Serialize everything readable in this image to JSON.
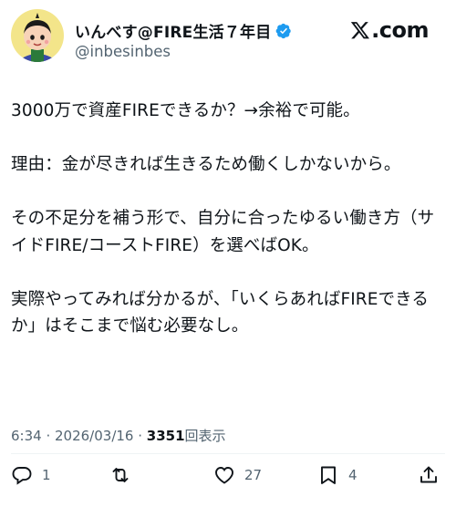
{
  "author": {
    "display_name": "いんべす@FIRE生活７年目",
    "handle": "@inbesinbes",
    "verified": true,
    "avatar_icon": "cartoon-avatar-icon"
  },
  "brand": {
    "logo_text": ".com",
    "logo_icon": "x-logo-icon"
  },
  "post": {
    "paragraphs": [
      "3000万で資産FIREできるか？→余裕で可能。",
      "理由：金が尽きれば生きるため働くしかないから。",
      "その不足分を補う形で、自分に合ったゆるい働き方（サイドFIRE/コーストFIRE）を選べばOK。",
      "実際やってみれば分かるが、「いくらあればFIREできるか」はそこまで悩む必要なし。"
    ]
  },
  "meta": {
    "time": "6:34",
    "separator": " · ",
    "date": "2026/03/16",
    "views_count": "3351",
    "views_label": "回表示"
  },
  "actions": {
    "reply_count": "1",
    "retweet_count": "",
    "like_count": "27",
    "bookmark_count": "4"
  },
  "colors": {
    "verified": "#1d9bf0",
    "muted": "#536471",
    "text": "#0f1419"
  }
}
